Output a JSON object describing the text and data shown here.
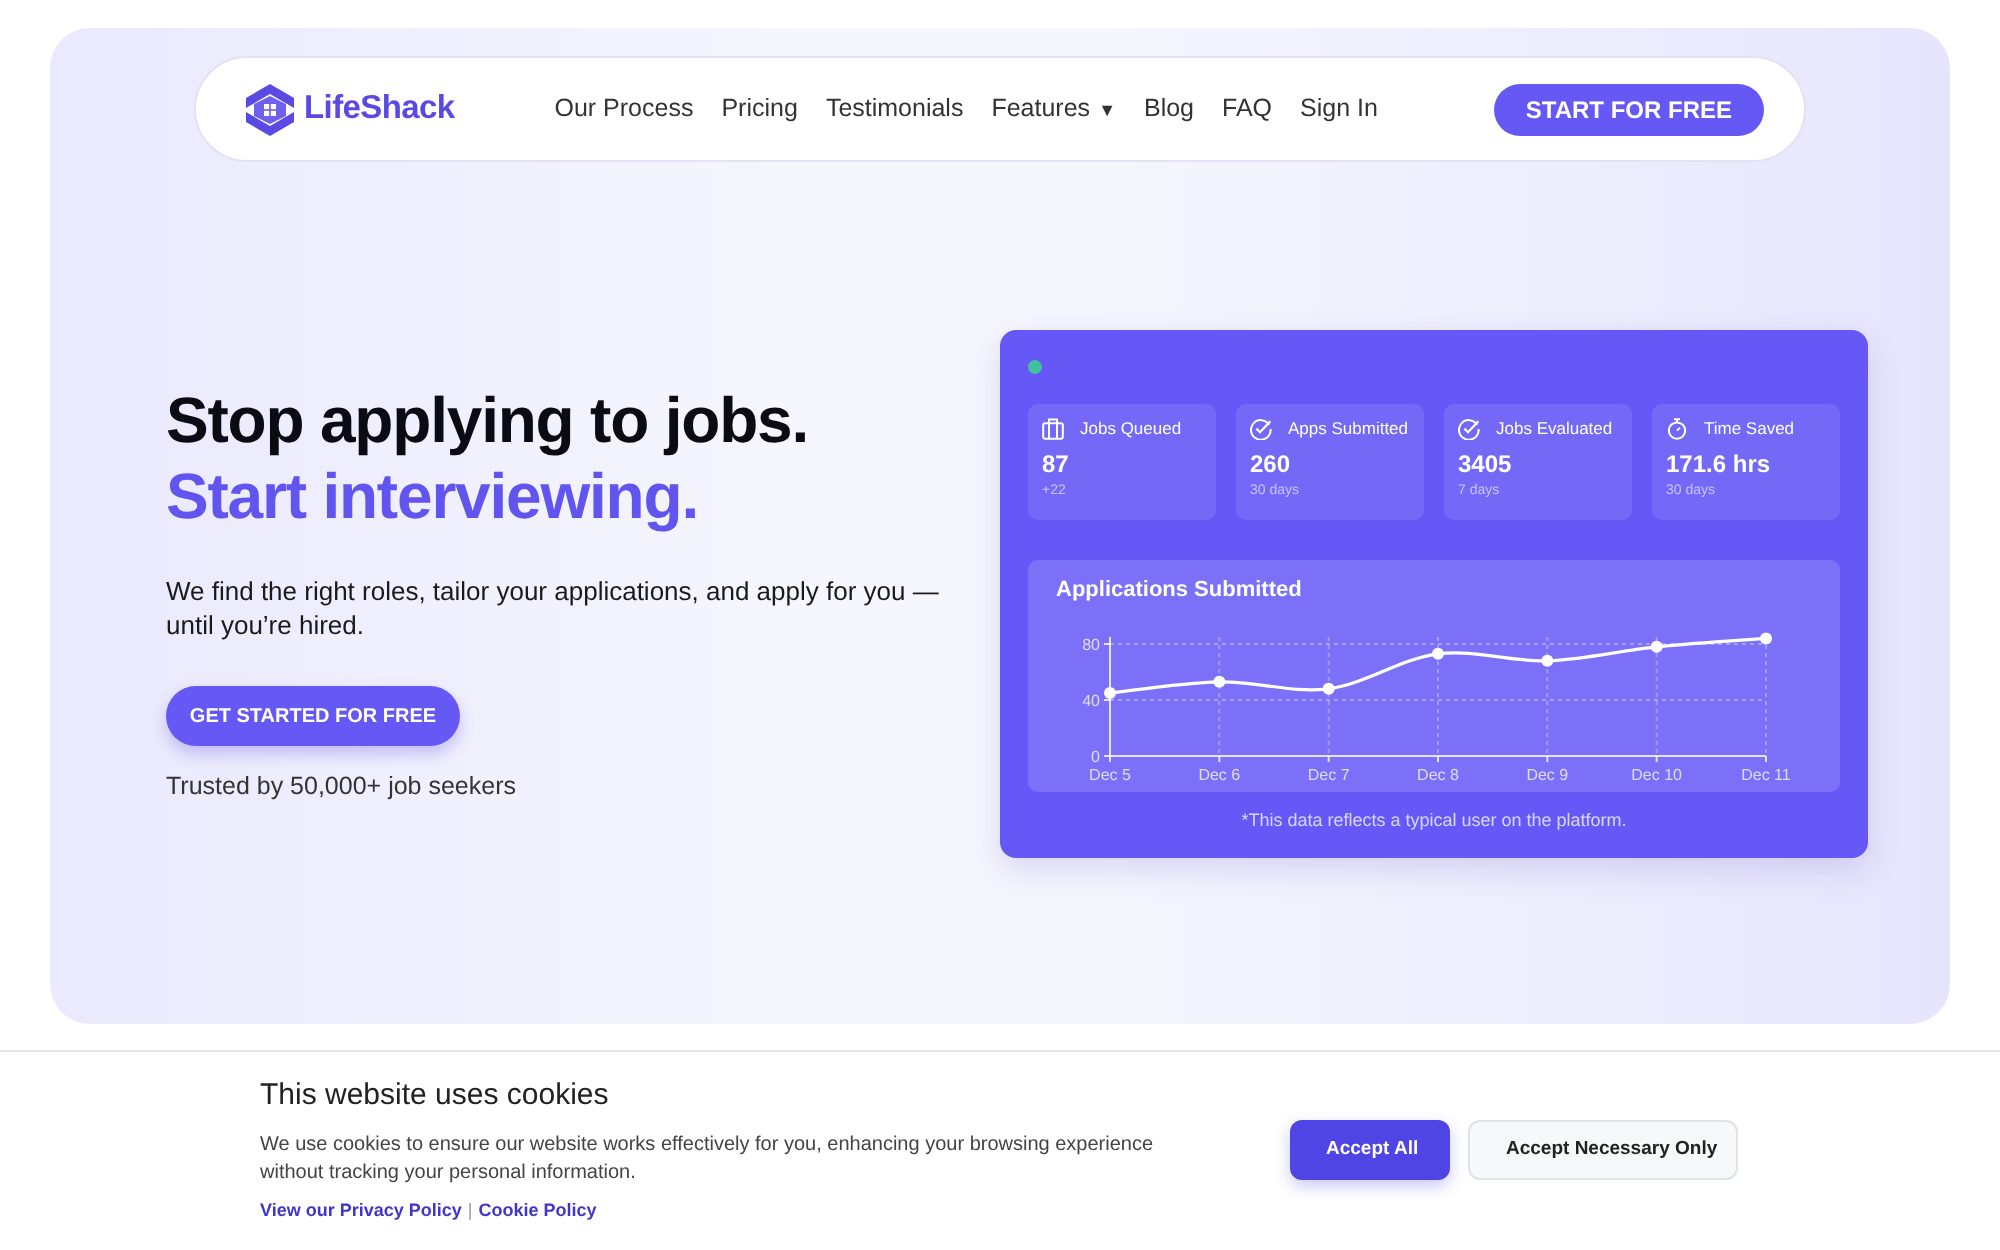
{
  "navbar": {
    "logo": "LifeShack",
    "links": [
      {
        "label": "Our Process"
      },
      {
        "label": "Pricing"
      },
      {
        "label": "Testimonials"
      },
      {
        "label": "Features",
        "caret": "▼"
      },
      {
        "label": "Blog"
      },
      {
        "label": "FAQ"
      },
      {
        "label": "Sign In"
      }
    ],
    "cta": "START FOR FREE"
  },
  "hero": {
    "headline": "Stop applying to jobs.",
    "headline_accent": "Start interviewing.",
    "text": "We find the right roles, tailor your applications, and apply for you — until you’re hired.",
    "button": "GET STARTED FOR FREE",
    "trust": "Trusted by 50,000+ job seekers"
  },
  "dashboard": {
    "stats": [
      {
        "kind": "queue",
        "label": "Jobs Queued",
        "value": "87",
        "note": "+22"
      },
      {
        "kind": "check",
        "label": "Apps Submitted",
        "value": "260",
        "note": "30 days"
      },
      {
        "kind": "check",
        "label": "Jobs Evaluated",
        "value": "3405",
        "note": "7 days"
      },
      {
        "kind": "timer",
        "label": "Time Saved",
        "value": "171.6 hrs",
        "note": "30 days"
      }
    ],
    "chart": {
      "chart_data": [
        {
          "type": "line",
          "title": "Applications Submitted",
          "categories": [
            "Dec 5",
            "Dec 6",
            "Dec 7",
            "Dec 8",
            "Dec 9",
            "Dec 10",
            "Dec 11"
          ],
          "values": [
            45,
            53,
            48,
            73,
            68,
            78,
            84
          ],
          "color": "#ffffff",
          "ylim": [
            0,
            85
          ],
          "yticks": [
            0,
            40,
            80
          ],
          "grid": true,
          "marker": "circle"
        }
      ]
    },
    "footnote": "*This data reflects a typical user on the platform."
  },
  "cookie_banner": {
    "title": "This website uses cookies",
    "text": "We use cookies to ensure our website works effectively for you, enhancing your browsing experience without tracking your personal information.",
    "links": [
      "View our Privacy Policy",
      "Cookie Policy"
    ],
    "separator": "|",
    "buttons": [
      {
        "kind": "primary",
        "label": "Accept All"
      },
      {
        "kind": "secondary",
        "label": "Accept Necessary Only"
      }
    ]
  }
}
